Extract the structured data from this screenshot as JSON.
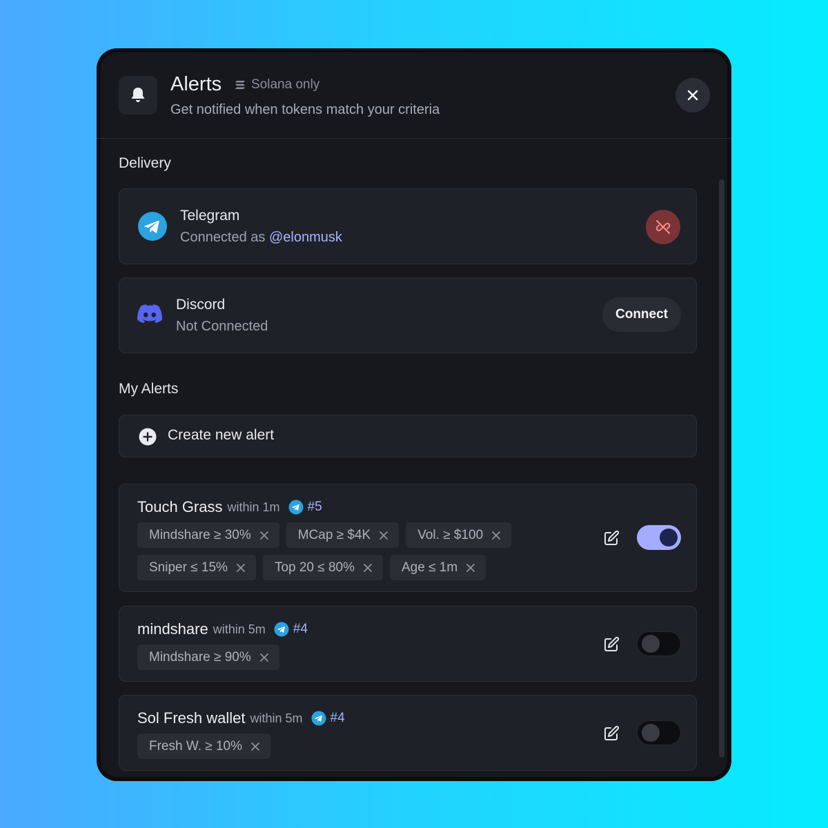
{
  "header": {
    "title": "Alerts",
    "chain_tag": "Solana only",
    "subtitle": "Get notified when tokens match your criteria",
    "icons": {
      "bell": "bell-icon",
      "close": "close-icon",
      "chain": "solana-icon"
    }
  },
  "delivery": {
    "label": "Delivery",
    "telegram": {
      "name": "Telegram",
      "status_prefix": "Connected as",
      "handle": "@elonmusk",
      "icon": "telegram-icon",
      "action_icon": "unlink-icon"
    },
    "discord": {
      "name": "Discord",
      "status": "Not Connected",
      "icon": "discord-icon",
      "connect_label": "Connect"
    }
  },
  "my_alerts": {
    "label": "My Alerts",
    "create_label": "Create new alert",
    "create_icon": "plus-circle-icon",
    "alerts": [
      {
        "name": "Touch Grass",
        "within": "within 1m",
        "channel_icon": "telegram-icon",
        "number": "#5",
        "enabled": true,
        "filters": [
          "Mindshare ≥ 30%",
          "MCap ≥ $4K",
          "Vol. ≥ $100",
          "Sniper ≤ 15%",
          "Top 20 ≤ 80%",
          "Age ≤ 1m"
        ]
      },
      {
        "name": "mindshare",
        "within": "within 5m",
        "channel_icon": "telegram-icon",
        "number": "#4",
        "enabled": false,
        "filters": [
          "Mindshare ≥ 90%"
        ]
      },
      {
        "name": "Sol Fresh wallet",
        "within": "within 5m",
        "channel_icon": "telegram-icon",
        "number": "#4",
        "enabled": false,
        "filters": [
          "Fresh W. ≥ 10%"
        ]
      }
    ]
  },
  "colors": {
    "accent": "#a6b4ff",
    "toggle_on": "#a4acff",
    "telegram": "#2aa3e0",
    "discord": "#5865f2",
    "danger": "#7a3436"
  }
}
